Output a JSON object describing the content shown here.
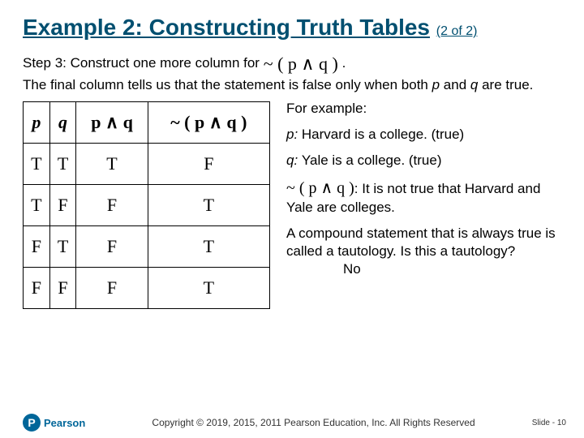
{
  "title_main": "Example 2: Constructing Truth Tables",
  "title_part": "(2 of 2)",
  "step_prefix": "Step 3: Construct one more column for ",
  "expr_neg_pandq": "~ ( p ∧ q )",
  "step_suffix": ".",
  "step_line2a": "The final column tells us that the statement is false only when both ",
  "p_var": "p",
  "and_word": " and ",
  "q_var": "q",
  "step_line2b": " are true.",
  "for_example": "For example:",
  "p_def_lead": "p: ",
  "p_def": "Harvard is a college. (true)",
  "q_def_lead": "q: ",
  "q_def": "Yale is a college. (true)",
  "colon_text": ": ",
  "conclusion": "It is not true that Harvard and Yale are colleges.",
  "tautology_text": "A compound statement that is always true is called a tautology. Is this a tautology?",
  "tautology_answer": "No",
  "table": {
    "head": {
      "c1": "p",
      "c2": "q",
      "c3": "p ∧ q",
      "c4": "~ ( p ∧ q )"
    },
    "rows": [
      {
        "p": "T",
        "q": "T",
        "pq": "T",
        "npq": "F"
      },
      {
        "p": "T",
        "q": "F",
        "pq": "F",
        "npq": "T"
      },
      {
        "p": "F",
        "q": "T",
        "pq": "F",
        "npq": "T"
      },
      {
        "p": "F",
        "q": "F",
        "pq": "F",
        "npq": "T"
      }
    ]
  },
  "footer": {
    "logo": "P",
    "brand": "Pearson",
    "copyright": "Copyright © 2019, 2015, 2011 Pearson Education, Inc. All Rights Reserved",
    "slide_label": "Slide - ",
    "slide_num": "10"
  }
}
